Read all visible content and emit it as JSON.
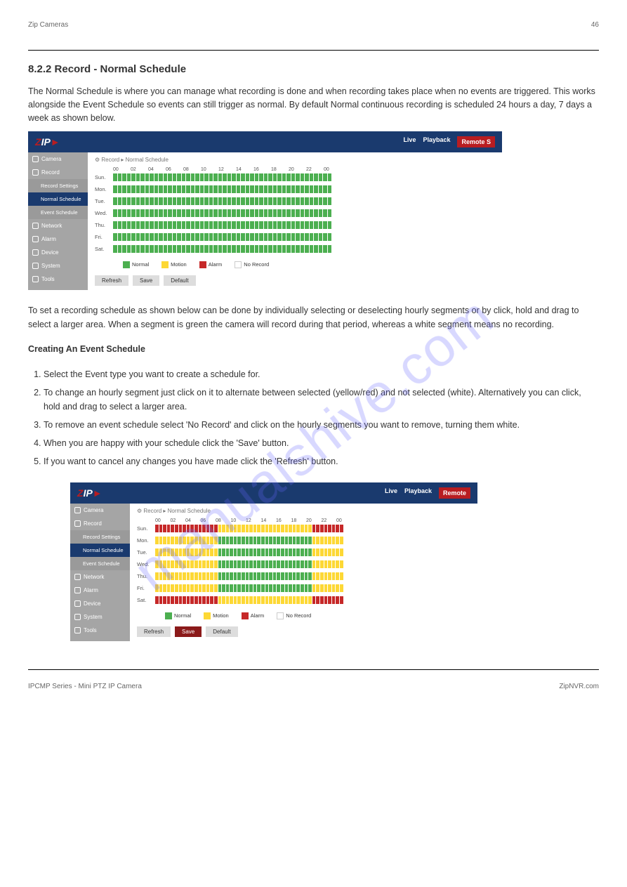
{
  "header": {
    "left": "Zip Cameras",
    "right": "46"
  },
  "section_title": "8.2.2 Record - Normal Schedule",
  "intro1": "The Normal Schedule is where you can manage what recording is done and when recording takes place when no events are triggered. This works alongside the Event Schedule so events can still trigger as normal. By default Normal continuous recording is scheduled 24 hours a day, 7 days a week as shown below.",
  "screenshot": {
    "nav": {
      "live": "Live",
      "playback": "Playback",
      "remote": "Remote S"
    },
    "sidebar": [
      {
        "label": "Camera",
        "icon": true
      },
      {
        "label": "Record",
        "icon": true
      },
      {
        "label": "Record Settings",
        "sub": true
      },
      {
        "label": "Normal Schedule",
        "sub": true,
        "active": true
      },
      {
        "label": "Event Schedule",
        "sub": true
      },
      {
        "label": "Network",
        "icon": true
      },
      {
        "label": "Alarm",
        "icon": true
      },
      {
        "label": "Device",
        "icon": true
      },
      {
        "label": "System",
        "icon": true
      },
      {
        "label": "Tools",
        "icon": true
      }
    ],
    "breadcrumb": "⚙ Record  ▸  Normal Schedule",
    "hours": [
      "00",
      "02",
      "04",
      "06",
      "08",
      "10",
      "12",
      "14",
      "16",
      "18",
      "20",
      "22",
      "00"
    ],
    "days": [
      "Sun.",
      "Mon.",
      "Tue.",
      "Wed.",
      "Thu.",
      "Fri.",
      "Sat."
    ],
    "legend": {
      "normal": "Normal",
      "motion": "Motion",
      "alarm": "Alarm",
      "norecord": "No Record"
    },
    "buttons": {
      "refresh": "Refresh",
      "save": "Save",
      "default": "Default"
    }
  },
  "after1": "To set a recording schedule as shown below can be done by individually selecting or deselecting hourly segments or by click, hold and drag to select a larger area. When a segment is green the camera will record during that period, whereas a white segment means no recording.",
  "steps_intro": "Creating An Event Schedule",
  "steps": [
    "Select the Event type you want to create a schedule for.",
    "To change an hourly segment just click on it to alternate between selected (yellow/red) and not selected (white). Alternatively you can click, hold and drag to select a larger area.",
    "To remove an event schedule select 'No Record' and click on the hourly segments you want to remove, turning them white.",
    "When you are happy with your schedule click the 'Save' button.",
    "If you want to cancel any changes you have made click the 'Refresh' button."
  ],
  "screenshot2": {
    "nav": {
      "live": "Live",
      "playback": "Playback",
      "remote": "Remote"
    },
    "buttons": {
      "refresh": "Refresh",
      "save": "Save",
      "default": "Default"
    }
  },
  "footer": {
    "left": "IPCMP Series - Mini PTZ IP Camera",
    "right": "ZipNVR.com"
  },
  "watermark": "manualshive.com",
  "chart_data": [
    {
      "type": "heatmap",
      "title": "Normal Schedule (default)",
      "x": [
        "00",
        "01",
        "02",
        "03",
        "04",
        "05",
        "06",
        "07",
        "08",
        "09",
        "10",
        "11",
        "12",
        "13",
        "14",
        "15",
        "16",
        "17",
        "18",
        "19",
        "20",
        "21",
        "22",
        "23"
      ],
      "y": [
        "Sun",
        "Mon",
        "Tue",
        "Wed",
        "Thu",
        "Fri",
        "Sat"
      ],
      "values_legend": {
        "N": "Normal",
        "M": "Motion",
        "A": "Alarm",
        "E": "No Record"
      },
      "grid": [
        "NNNNNNNNNNNNNNNNNNNNNNNN",
        "NNNNNNNNNNNNNNNNNNNNNNNN",
        "NNNNNNNNNNNNNNNNNNNNNNNN",
        "NNNNNNNNNNNNNNNNNNNNNNNN",
        "NNNNNNNNNNNNNNNNNNNNNNNN",
        "NNNNNNNNNNNNNNNNNNNNNNNN",
        "NNNNNNNNNNNNNNNNNNNNNNNN"
      ]
    },
    {
      "type": "heatmap",
      "title": "Normal Schedule (example)",
      "x": [
        "00",
        "01",
        "02",
        "03",
        "04",
        "05",
        "06",
        "07",
        "08",
        "09",
        "10",
        "11",
        "12",
        "13",
        "14",
        "15",
        "16",
        "17",
        "18",
        "19",
        "20",
        "21",
        "22",
        "23"
      ],
      "y": [
        "Sun",
        "Mon",
        "Tue",
        "Wed",
        "Thu",
        "Fri",
        "Sat"
      ],
      "values_legend": {
        "N": "Normal",
        "M": "Motion",
        "A": "Alarm",
        "E": "No Record"
      },
      "grid": [
        "AAAAAAAAMMMMMMMMMMMMAAAA",
        "MMMMMMMMNNNNNNNNNNNNMMMM",
        "MMMMMMMMNNNNNNNNNNNNMMMM",
        "MMMMMMMMNNNNNNNNNNNNMMMM",
        "MMMMMMMMNNNNNNNNNNNNMMMM",
        "MMMMMMMMNNNNNNNNNNNNMMMM",
        "AAAAAAAAMMMMMMMMMMMMAAAA"
      ]
    }
  ]
}
